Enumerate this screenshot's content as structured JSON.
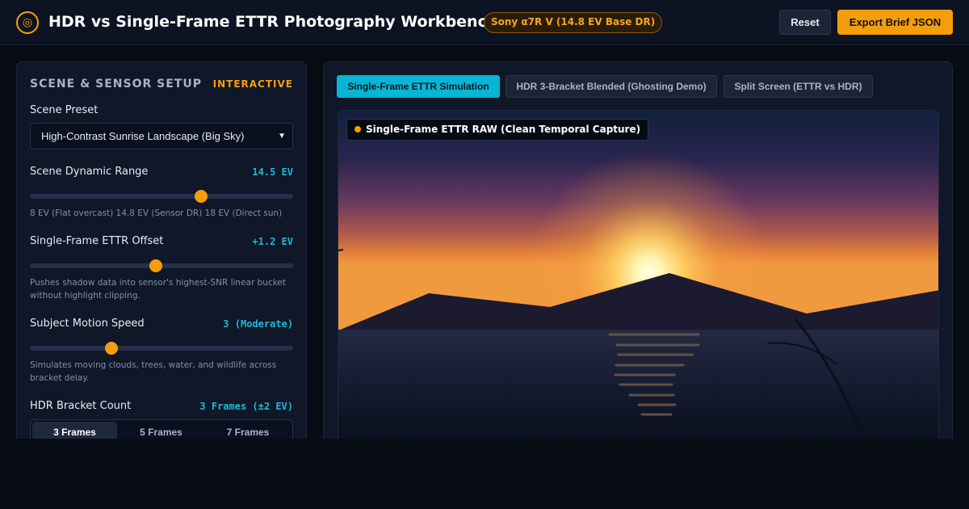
{
  "header": {
    "title": "HDR vs Single-Frame ETTR Photography Workbench",
    "camera_badge": "Sony α7R V (14.8 EV Base DR)",
    "reset_label": "Reset",
    "export_label": "Export Brief JSON",
    "logo_icon": "aperture-icon"
  },
  "left_panel": {
    "title": "SCENE & SENSOR SETUP",
    "badge": "INTERACTIVE",
    "scene_preset": {
      "label": "Scene Preset",
      "value": "High-Contrast Sunrise Landscape (Big Sky)"
    },
    "dynamic_range": {
      "label": "Scene Dynamic Range",
      "value": "14.5 EV",
      "level": 0.65,
      "hint": "8 EV (Flat overcast) 14.8 EV (Sensor DR) 18 EV (Direct sun)"
    },
    "ettr_offset": {
      "label": "Single-Frame ETTR Offset",
      "value": "+1.2 EV",
      "level": 0.48,
      "hint": "Pushes shadow data into sensor's highest-SNR linear bucket without highlight clipping."
    },
    "motion_speed": {
      "label": "Subject Motion Speed",
      "value": "3 (Moderate)",
      "level": 0.31,
      "hint": "Simulates moving clouds, trees, water, and wildlife across bracket delay."
    },
    "bracket_count": {
      "label": "HDR Bracket Count",
      "value": "3 Frames (±2 EV)",
      "options": [
        "3 Frames",
        "5 Frames",
        "7 Frames"
      ],
      "selected": "3 Frames"
    }
  },
  "right_panel": {
    "tabs": [
      {
        "label": "Single-Frame ETTR Simulation",
        "active": true
      },
      {
        "label": "HDR 3-Bracket Blended (Ghosting Demo)",
        "active": false
      },
      {
        "label": "Split Screen (ETTR vs HDR)",
        "active": false
      }
    ],
    "preview_label": "Single-Frame ETTR RAW (Clean Temporal Capture)"
  },
  "colors": {
    "accent": "#f59e0b",
    "value_cyan": "#22b8d6",
    "tab_active": "#06b6d4"
  }
}
